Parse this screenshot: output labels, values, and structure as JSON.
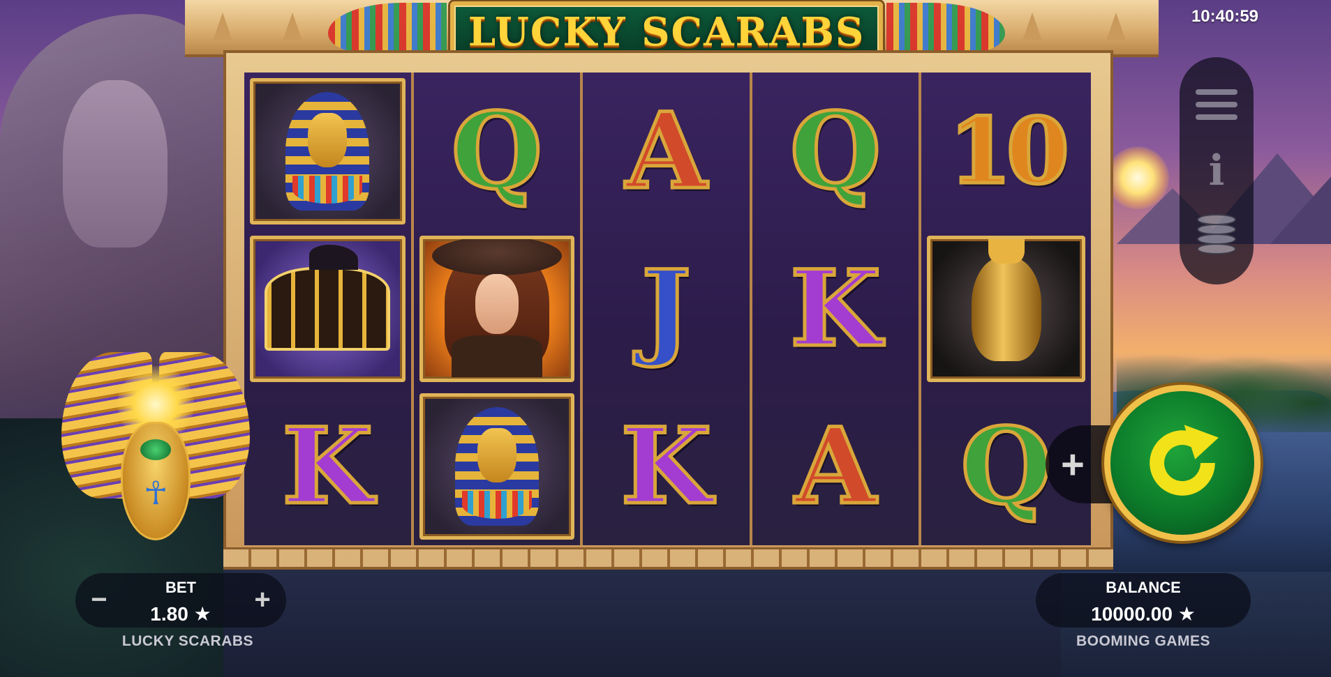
{
  "game": {
    "title": "LUCKY SCARABS",
    "name": "LUCKY SCARABS",
    "provider": "BOOMING GAMES"
  },
  "clock": "10:40:59",
  "reels": [
    [
      {
        "type": "picture",
        "symbol": "pharaoh"
      },
      {
        "type": "picture",
        "symbol": "treasure-chest"
      },
      {
        "type": "letter",
        "symbol": "K",
        "color": "purple"
      }
    ],
    [
      {
        "type": "letter",
        "symbol": "Q",
        "color": "green"
      },
      {
        "type": "picture",
        "symbol": "explorer"
      },
      {
        "type": "picture",
        "symbol": "pharaoh"
      }
    ],
    [
      {
        "type": "letter",
        "symbol": "A",
        "color": "red"
      },
      {
        "type": "letter",
        "symbol": "J",
        "color": "blue"
      },
      {
        "type": "letter",
        "symbol": "K",
        "color": "purple"
      }
    ],
    [
      {
        "type": "letter",
        "symbol": "Q",
        "color": "green"
      },
      {
        "type": "letter",
        "symbol": "K",
        "color": "purple"
      },
      {
        "type": "letter",
        "symbol": "A",
        "color": "red"
      }
    ],
    [
      {
        "type": "letter",
        "symbol": "10",
        "color": "orange"
      },
      {
        "type": "picture",
        "symbol": "canopic-jar"
      },
      {
        "type": "letter",
        "symbol": "Q",
        "color": "green"
      }
    ]
  ],
  "bet": {
    "label": "BET",
    "value": "1.80 ★",
    "minus": "−",
    "plus": "+"
  },
  "balance": {
    "label": "BALANCE",
    "value": "10000.00 ★"
  },
  "side_menu": [
    "menu-icon",
    "info-icon",
    "coins-icon"
  ],
  "autoplay": {
    "glyph": "+"
  },
  "spin": {
    "icon": "spin-arrow-icon"
  },
  "colors": {
    "spin_green": "#0c7a2a",
    "gold": "#f0c049",
    "title_yellow": "#ffd43a",
    "panel_bg": "#0a0c18"
  }
}
